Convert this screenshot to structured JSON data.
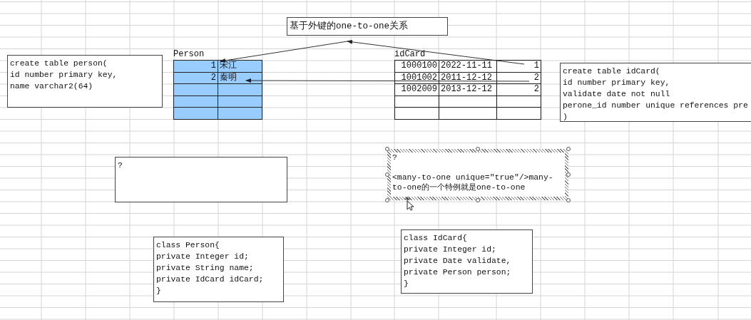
{
  "title_box": {
    "text": "基于外键的one-to-one关系"
  },
  "tables": [
    {
      "caption": "Person",
      "kind": "filled",
      "rows": [
        [
          "1",
          "宋江"
        ],
        [
          "2",
          "秦明"
        ]
      ]
    },
    {
      "caption": "idCard",
      "kind": "plain",
      "rows": [
        [
          "1000100",
          "2022-11-11",
          "1"
        ],
        [
          "1001002",
          "2011-12-12",
          "2"
        ],
        [
          "1002009",
          "2013-12-12",
          "2"
        ]
      ]
    }
  ],
  "text_boxes": [
    {
      "selected": false,
      "paragraphs": [
        [
          "create table person(",
          "id number primary key,",
          "name varchar2(64)"
        ]
      ]
    },
    {
      "selected": false,
      "paragraphs": [
        [
          "create table idCard(",
          "id number primary key,",
          "validate date not null",
          "perone_id number unique references pre",
          ")"
        ]
      ]
    },
    {
      "selected": false,
      "paragraphs": [
        [
          "?"
        ]
      ]
    },
    {
      "selected": true,
      "paragraphs": [
        [
          "?"
        ],
        [
          "<many-to-one unique=\"true\"/>many-",
          "to-one的一个特例就是one-to-one"
        ]
      ]
    },
    {
      "selected": false,
      "paragraphs": [
        [
          "class Person{",
          "private Integer id;",
          "private String name;",
          "private IdCard idCard;",
          "}"
        ]
      ]
    },
    {
      "selected": false,
      "paragraphs": [
        [
          "class IdCard{",
          "private Integer id;",
          "private Date validate,",
          "private Person person;",
          "}"
        ]
      ]
    }
  ]
}
